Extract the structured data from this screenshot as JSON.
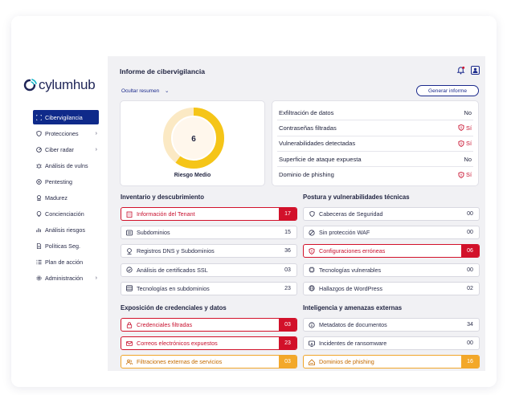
{
  "app": {
    "logo_text": "cylumhub"
  },
  "sidebar": {
    "items": [
      {
        "label": "Cibervigilancia",
        "icon": "scan-icon",
        "active": true,
        "chevron": false
      },
      {
        "label": "Protecciones",
        "icon": "shield-icon",
        "active": false,
        "chevron": true
      },
      {
        "label": "Ciber radar",
        "icon": "radar-icon",
        "active": false,
        "chevron": true
      },
      {
        "label": "Análisis de vulns",
        "icon": "bug-icon",
        "active": false,
        "chevron": false
      },
      {
        "label": "Pentesting",
        "icon": "target-icon",
        "active": false,
        "chevron": false
      },
      {
        "label": "Madurez",
        "icon": "badge-icon",
        "active": false,
        "chevron": false
      },
      {
        "label": "Concienciación",
        "icon": "bulb-icon",
        "active": false,
        "chevron": false
      },
      {
        "label": "Análisis riesgos",
        "icon": "chart-icon",
        "active": false,
        "chevron": false
      },
      {
        "label": "Políticas Seg.",
        "icon": "document-icon",
        "active": false,
        "chevron": false
      },
      {
        "label": "Plan de acción",
        "icon": "checklist-icon",
        "active": false,
        "chevron": false
      },
      {
        "label": "Administración",
        "icon": "gear-icon",
        "active": false,
        "chevron": true
      }
    ]
  },
  "header": {
    "title": "Informe de cibervigilancia",
    "toggle_summary": "Ocultar resumen",
    "generate_button": "Generar informe"
  },
  "gauge": {
    "value": "6",
    "label": "Riesgo Medio",
    "fraction": 0.6,
    "color": "#f5c518"
  },
  "summary": [
    {
      "label": "Exfiltración de datos",
      "value": "No",
      "bad": false
    },
    {
      "label": "Contraseñas filtradas",
      "value": "Sí",
      "bad": true
    },
    {
      "label": "Vulnerabilidades detectadas",
      "value": "Sí",
      "bad": true
    },
    {
      "label": "Superficie de ataque expuesta",
      "value": "No",
      "bad": false
    },
    {
      "label": "Dominio de phishing",
      "value": "Sí",
      "bad": true
    }
  ],
  "sections": {
    "inventario": {
      "title": "Inventario y descubrimiento",
      "rows": [
        {
          "label": "Información del Tenant",
          "value": "17",
          "status": "red",
          "icon": "building-icon"
        },
        {
          "label": "Subdominios",
          "value": "15",
          "status": "normal",
          "icon": "list-icon"
        },
        {
          "label": "Registros DNS y Subdominios",
          "value": "36",
          "status": "normal",
          "icon": "dns-icon"
        },
        {
          "label": "Análisis de certificados SSL",
          "value": "03",
          "status": "normal",
          "icon": "certificate-icon"
        },
        {
          "label": "Tecnologías en subdominios",
          "value": "23",
          "status": "normal",
          "icon": "server-icon"
        }
      ]
    },
    "postura": {
      "title": "Postura y vulnerabilidades técnicas",
      "rows": [
        {
          "label": "Cabeceras de Seguridad",
          "value": "00",
          "status": "normal",
          "icon": "shield-icon"
        },
        {
          "label": "Sin protección WAF",
          "value": "00",
          "status": "normal",
          "icon": "block-icon"
        },
        {
          "label": "Configuraciones erróneas",
          "value": "06",
          "status": "red",
          "icon": "warning-shield-icon"
        },
        {
          "label": "Tecnologías vulnerables",
          "value": "00",
          "status": "normal",
          "icon": "chip-icon"
        },
        {
          "label": "Hallazgos de WordPress",
          "value": "02",
          "status": "normal",
          "icon": "globe-icon"
        }
      ]
    },
    "exposicion": {
      "title": "Exposición de credenciales y datos",
      "rows": [
        {
          "label": "Credenciales filtradas",
          "value": "03",
          "status": "red",
          "icon": "lock-icon"
        },
        {
          "label": "Correos electrónicos expuestos",
          "value": "23",
          "status": "red",
          "icon": "mail-icon"
        },
        {
          "label": "Filtraciones externas de servicios",
          "value": "03",
          "status": "orange",
          "icon": "users-icon"
        }
      ]
    },
    "inteligencia": {
      "title": "Inteligencia y amenazas externas",
      "rows": [
        {
          "label": "Metadatos de documentos",
          "value": "34",
          "status": "normal",
          "icon": "info-icon"
        },
        {
          "label": "Incidentes de ransomware",
          "value": "00",
          "status": "normal",
          "icon": "ransomware-icon"
        },
        {
          "label": "Dominios de phishing",
          "value": "16",
          "status": "orange",
          "icon": "phishing-icon"
        }
      ]
    }
  },
  "colors": {
    "accent": "#0f2a8a",
    "danger": "#d2112a",
    "warning": "#f3a82a",
    "gauge": "#f5c518"
  }
}
